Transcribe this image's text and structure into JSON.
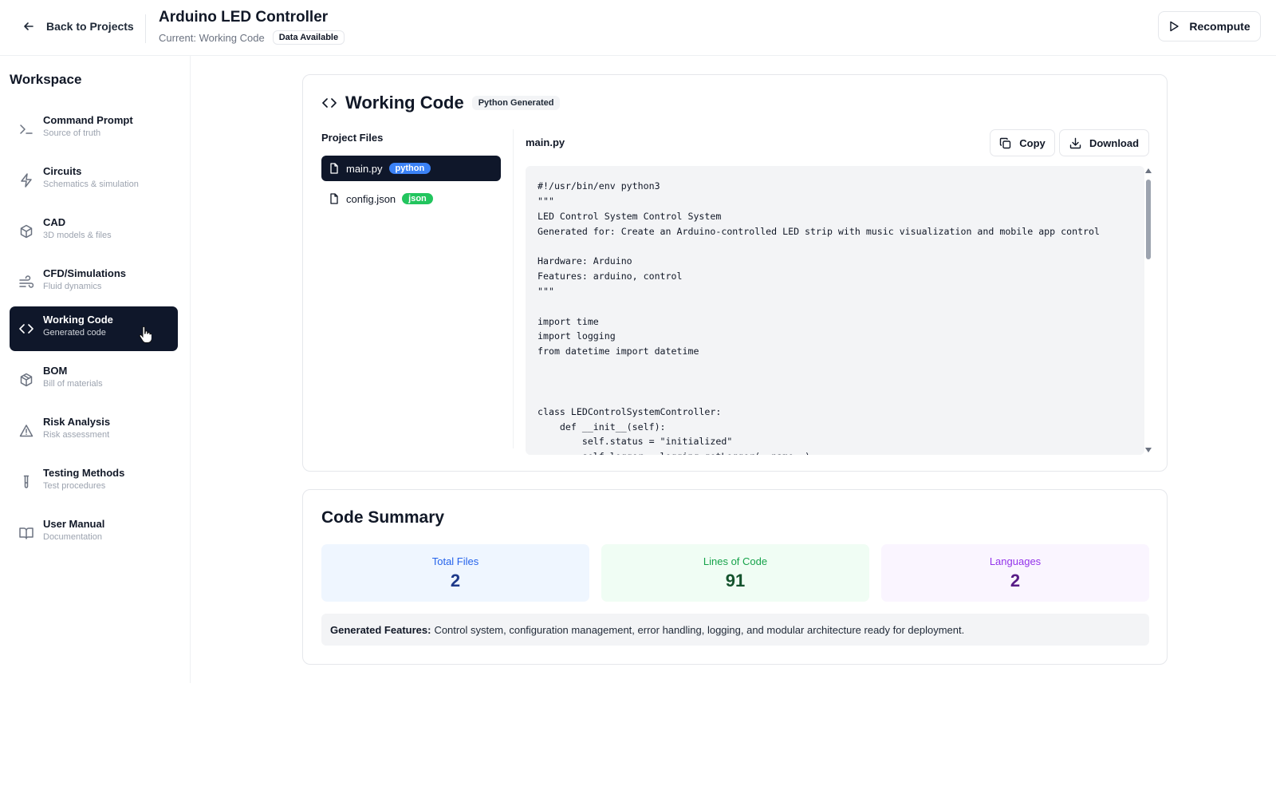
{
  "header": {
    "back_label": "Back to Projects",
    "project_title": "Arduino LED Controller",
    "current_view": "Current: Working Code",
    "status_badge": "Data Available",
    "recompute_label": "Recompute"
  },
  "sidebar": {
    "title": "Workspace",
    "items": [
      {
        "label": "Command Prompt",
        "desc": "Source of truth",
        "icon": "terminal-icon"
      },
      {
        "label": "Circuits",
        "desc": "Schematics & simulation",
        "icon": "lightning-icon"
      },
      {
        "label": "CAD",
        "desc": "3D models & files",
        "icon": "cube-icon"
      },
      {
        "label": "CFD/Simulations",
        "desc": "Fluid dynamics",
        "icon": "wind-icon"
      },
      {
        "label": "Working Code",
        "desc": "Generated code",
        "icon": "code-icon",
        "active": true
      },
      {
        "label": "BOM",
        "desc": "Bill of materials",
        "icon": "package-icon"
      },
      {
        "label": "Risk Analysis",
        "desc": "Risk assessment",
        "icon": "warning-icon"
      },
      {
        "label": "Testing Methods",
        "desc": "Test procedures",
        "icon": "test-tube-icon"
      },
      {
        "label": "User Manual",
        "desc": "Documentation",
        "icon": "book-icon"
      }
    ]
  },
  "code_panel": {
    "title": "Working Code",
    "badge": "Python Generated",
    "files_title": "Project Files",
    "files": [
      {
        "name": "main.py",
        "lang": "python",
        "active": true
      },
      {
        "name": "config.json",
        "lang": "json",
        "active": false
      }
    ],
    "selected_file": "main.py",
    "copy_label": "Copy",
    "download_label": "Download",
    "code": "#!/usr/bin/env python3\n\"\"\"\nLED Control System Control System\nGenerated for: Create an Arduino-controlled LED strip with music visualization and mobile app control\n\nHardware: Arduino\nFeatures: arduino, control\n\"\"\"\n\nimport time\nimport logging\nfrom datetime import datetime\n\n\n\nclass LEDControlSystemController:\n    def __init__(self):\n        self.status = \"initialized\"\n        self.logger = logging.getLogger(__name__)"
  },
  "summary": {
    "title": "Code Summary",
    "total_files_label": "Total Files",
    "total_files": "2",
    "lines_label": "Lines of Code",
    "lines": "91",
    "languages_label": "Languages",
    "languages": "2",
    "features_label": "Generated Features:",
    "features_text": "Control system, configuration management, error handling, logging, and modular architecture ready for deployment."
  },
  "colors": {
    "active_nav_bg": "#0f172a",
    "python_pill": "#3b82f6",
    "json_pill": "#22c55e"
  }
}
